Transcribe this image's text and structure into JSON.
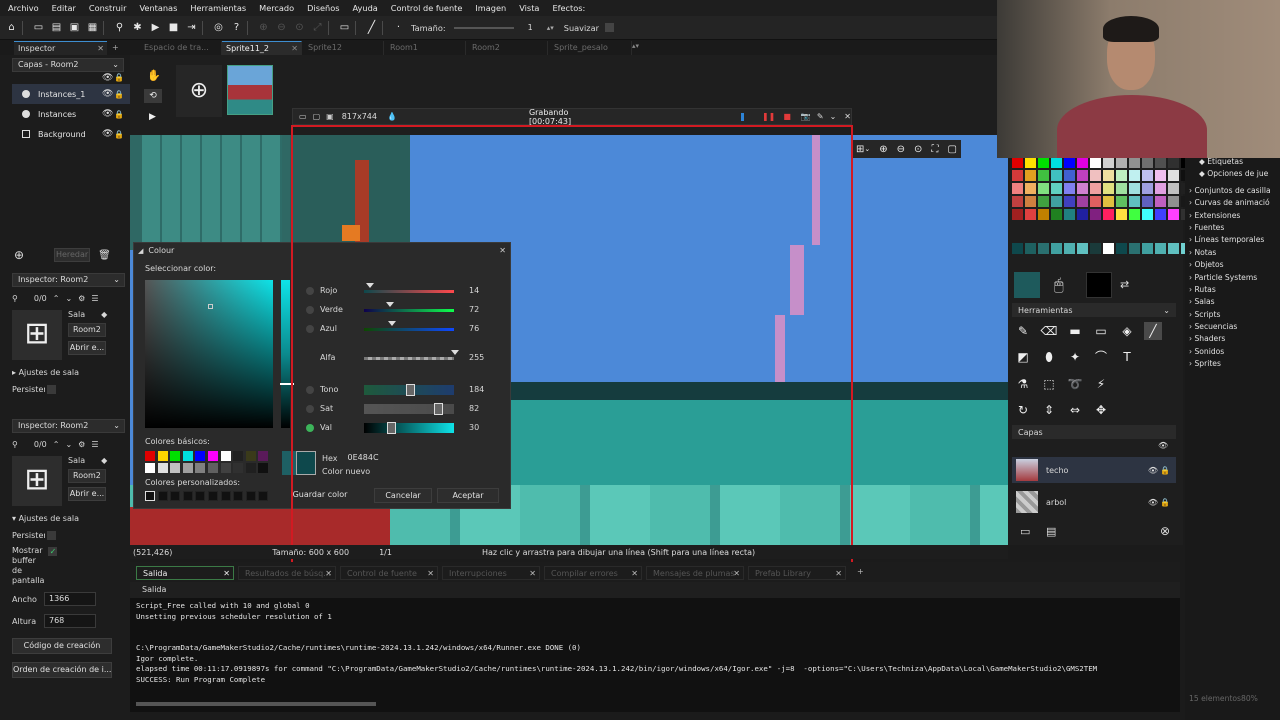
{
  "menu": [
    "Archivo",
    "Editar",
    "Construir",
    "Ventanas",
    "Herramientas",
    "Mercado",
    "Diseños",
    "Ayuda",
    "Control de fuente",
    "Imagen",
    "Vista",
    "Efectos:"
  ],
  "toolbar": {
    "size_label": "Tamaño:",
    "size_value": "1",
    "smooth_label": "Suavizar"
  },
  "tabs": [
    "Espacio de tra...",
    "Sprite11_2",
    "Sprite12",
    "Room1",
    "Room2",
    "Sprite_pesalo"
  ],
  "inspector_tab": "Inspector",
  "layers_panel": {
    "title": "Capas - Room2",
    "items": [
      "Instances_1",
      "Instances",
      "Background"
    ],
    "inherit": "Heredar"
  },
  "inspector1": {
    "title": "Inspector: Room2",
    "counter": "0/0",
    "room_label": "Sala",
    "room_name": "Room2",
    "open": "Abrir e...",
    "section": "Ajustes de sala",
    "persist": "Persistente"
  },
  "inspector2": {
    "title": "Inspector: Room2",
    "counter": "0/0",
    "room_label": "Sala",
    "room_name": "Room2",
    "open": "Abrir e...",
    "section": "Ajustes de sala",
    "persist": "Persistente",
    "show_buffer": [
      "Mostrar",
      "buffer",
      "de",
      "pantalla"
    ],
    "width_label": "Ancho",
    "width": "1366",
    "height_label": "Altura",
    "height": "768",
    "creation_code": "Código de creación",
    "creation_order": "Orden de creación de i..."
  },
  "recorder": {
    "size": "817x744",
    "status": "Grabando [00:07:43]"
  },
  "colour_dialog": {
    "title": "Colour",
    "select_label": "Seleccionar color:",
    "red_label": "Rojo",
    "red": "14",
    "green_label": "Verde",
    "green": "72",
    "blue_label": "Azul",
    "blue": "76",
    "alpha_label": "Alfa",
    "alpha": "255",
    "hue_label": "Tono",
    "hue": "184",
    "sat_label": "Sat",
    "sat": "82",
    "val_label": "Val",
    "val": "30",
    "basic_label": "Colores básicos:",
    "custom_label": "Colores personalizados:",
    "hex_label": "Hex",
    "hex": "0E484C",
    "new_label": "Color nuevo",
    "save": "Guardar color",
    "cancel": "Cancelar",
    "accept": "Aceptar",
    "selected_color": "#0e484c"
  },
  "status_bar": {
    "coords": "(521,426)",
    "size": "Tamaño: 600 x 600",
    "frame": "1/1",
    "hint": "Haz clic y arrastra para dibujar una línea (Shift para una línea recta)"
  },
  "output": {
    "tabs": [
      "Salida",
      "Resultados de búsq...",
      "Control de fuente",
      "Interrupciones",
      "Compilar errores",
      "Mensajes de plumas",
      "Prefab Library"
    ],
    "header": "Salida",
    "lines": [
      "Script_Free called with 10 and global 0",
      "Unsetting previous scheduler resolution of 1",
      "",
      "",
      "C:\\ProgramData/GameMakerStudio2/Cache/runtimes\\runtime-2024.13.1.242/windows/x64/Runner.exe DONE (0)",
      "Igor complete.",
      "elapsed time 00:11:17.0919897s for command \"C:\\ProgramData/GameMakerStudio2/Cache/runtimes\\runtime-2024.13.1.242/bin/igor/windows/x64/Igor.exe\" -j=8  -options=\"C:\\Users\\Techniza\\AppData\\Local\\GameMakerStudio2\\GMS2TEM",
      "SUCCESS: Run Program Complete"
    ]
  },
  "tools": {
    "title": "Herramientas"
  },
  "sprite_layers": {
    "title": "Capas",
    "items": [
      "techo",
      "arbol"
    ]
  },
  "asset_tree": [
    "Etiquetas",
    "Opciones de jue",
    "Conjuntos de casilla",
    "Curvas de animació",
    "Extensiones",
    "Fuentes",
    "Líneas temporales",
    "Notas",
    "Objetos",
    "Particle Systems",
    "Rutas",
    "Salas",
    "Scripts",
    "Secuencias",
    "Shaders",
    "Sonidos",
    "Sprites"
  ],
  "asset_footer": "15 elementos80%",
  "colors": {
    "accent": "#3e8ed0",
    "record": "#d21a22",
    "sky": "#4c89d8",
    "teal": "#46b6a7"
  }
}
